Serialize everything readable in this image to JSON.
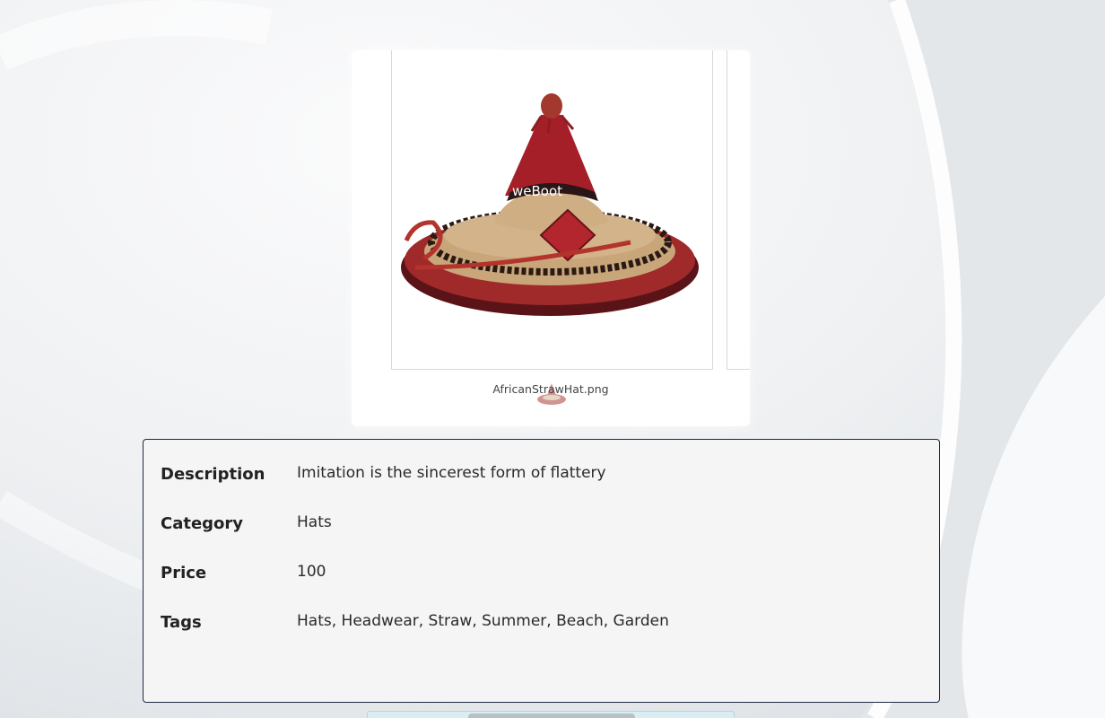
{
  "gallery": {
    "file_name": "AfricanStrawHat.png",
    "image_brand_text": "weBoot"
  },
  "details": {
    "rows": [
      {
        "label": "Description",
        "value": "Imitation is the sincerest form of flattery"
      },
      {
        "label": "Category",
        "value": "Hats"
      },
      {
        "label": "Price",
        "value": "100"
      },
      {
        "label": "Tags",
        "value": "Hats, Headwear, Straw, Summer, Beach, Garden"
      }
    ]
  },
  "colors": {
    "hat_red": "#9c1c24",
    "straw": "#cfae84",
    "panel_border": "#1e2a44",
    "panel_bg": "#f5f5f6"
  }
}
